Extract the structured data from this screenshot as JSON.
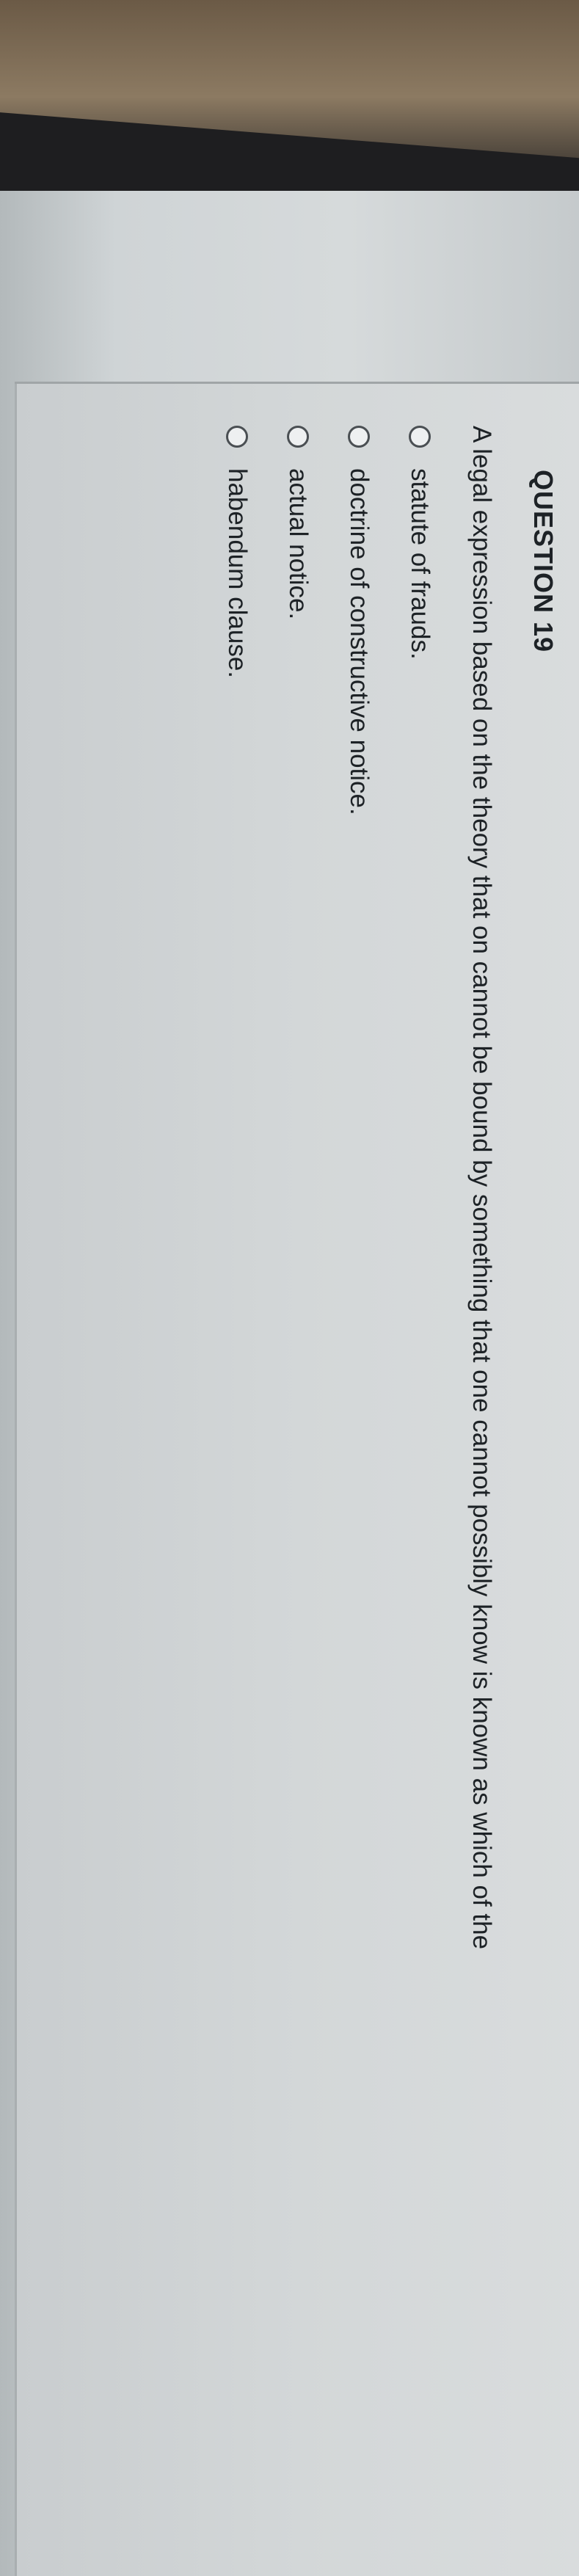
{
  "question": {
    "title": "QUESTION 19",
    "text": "A legal expression based on the theory that on cannot be bound by something that one cannot possibly know is known as which of the",
    "options": [
      {
        "label": "statute of frauds."
      },
      {
        "label": "doctrine of constructive notice."
      },
      {
        "label": "actual notice."
      },
      {
        "label": "habendum clause."
      }
    ]
  }
}
